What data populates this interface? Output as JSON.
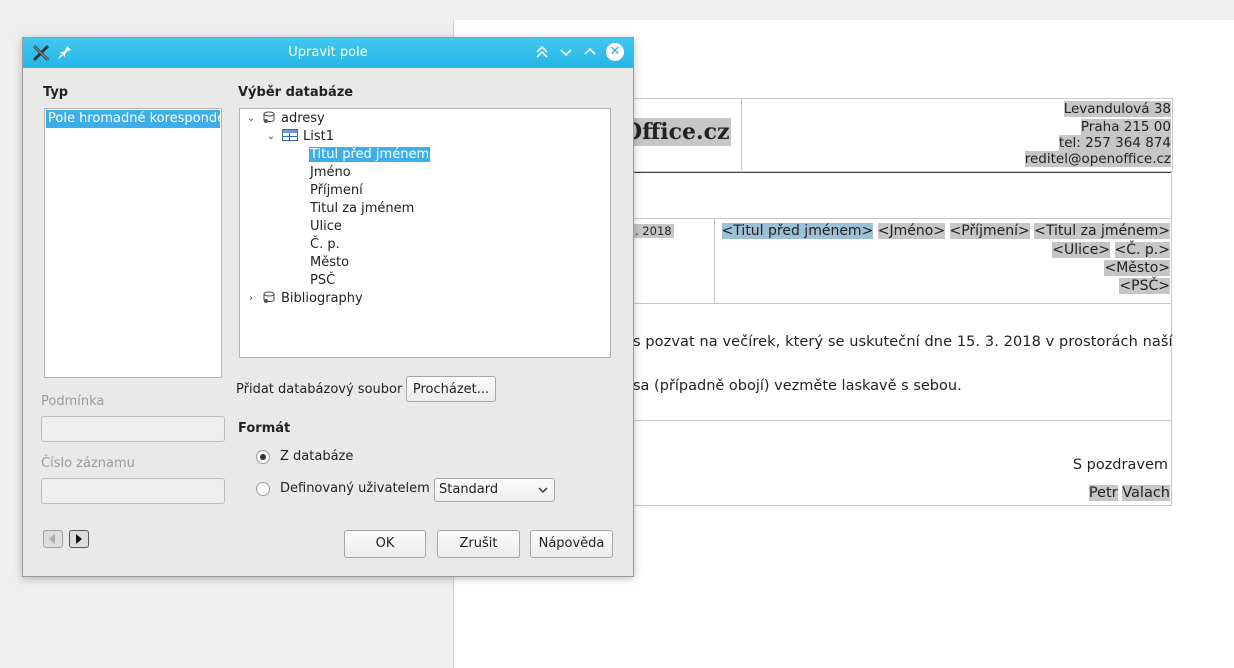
{
  "document": {
    "logo_text": "Office.cz",
    "address": [
      "Levandulová 38",
      "Praha 215 00",
      "tel: 257 364 874",
      "reditel@openoffice.cz"
    ],
    "date_fragment": ". 2018",
    "fields_line1": [
      "<Titul před jménem>",
      "<Jméno>",
      "<Příjmení>",
      "<Titul za jménem>"
    ],
    "fields_line2": [
      "<Ulice>",
      "<Č. p.>"
    ],
    "fields_line3": "<Město>",
    "fields_line4": "<PSČ>",
    "para1": "s pozvat na večírek, který se uskuteční dne 15. 3. 2018 v prostorách naší",
    "para2": "sa (případně obojí) vezměte laskavě s sebou.",
    "greeting": "S pozdravem",
    "signature_first": "Petr",
    "signature_last": "Valach"
  },
  "dialog": {
    "title": "Upravit pole",
    "type_label": "Typ",
    "type_items": [
      "Pole hromadné korespondence"
    ],
    "db_selection_label": "Výběr databáze",
    "tree": {
      "db1": "adresy",
      "table1": "List1",
      "fields": [
        "Titul před jménem",
        "Jméno",
        "Příjmení",
        "Titul za jménem",
        "Ulice",
        "Č. p.",
        "Město",
        "PSČ"
      ],
      "db2": "Bibliography"
    },
    "condition_label": "Podmínka",
    "record_number_label": "Číslo záznamu",
    "add_db_file_label": "Přidat databázový soubor",
    "browse_button": "Procházet...",
    "format_label": "Formát",
    "radio_from_db": "Z databáze",
    "radio_user_defined": "Definovaný uživatelem",
    "format_select_value": "Standard",
    "ok_button": "OK",
    "cancel_button": "Zrušit",
    "help_button": "Nápověda"
  },
  "colors": {
    "titlebar": "#2bb8e7",
    "selection": "#3daee9",
    "field_shade": "#c6c6c6"
  }
}
